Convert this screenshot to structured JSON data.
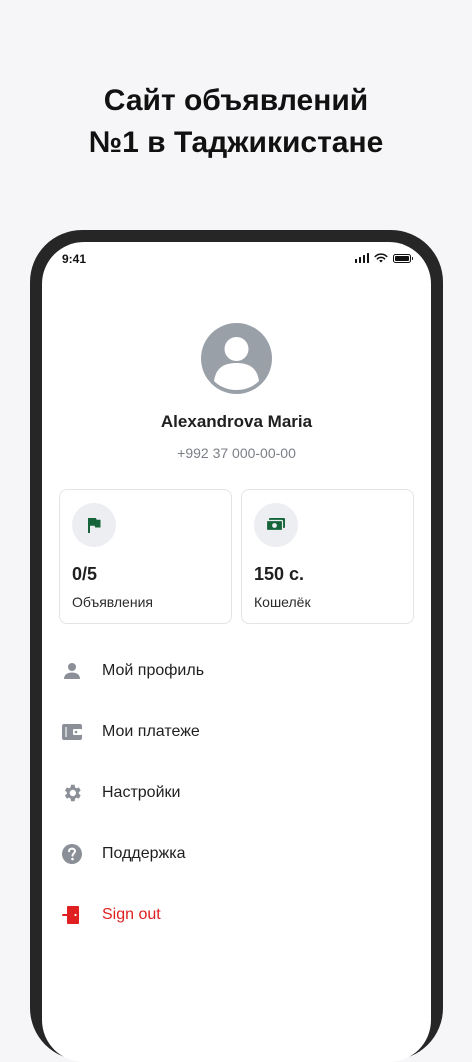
{
  "promo": {
    "line1": "Сайт объявлений",
    "line2": "№1 в Таджикистане"
  },
  "status_bar": {
    "time": "9:41",
    "icons": [
      "signal-icon",
      "wifi-icon",
      "battery-icon"
    ]
  },
  "profile": {
    "name": "Alexandrova Maria",
    "phone": "+992 37 000-00-00"
  },
  "cards": [
    {
      "icon": "flag-icon",
      "value": "0/5",
      "label": "Объявления"
    },
    {
      "icon": "money-icon",
      "value": "150 с.",
      "label": "Кошелёк"
    }
  ],
  "menu": [
    {
      "icon": "person-icon",
      "label": "Мой профиль"
    },
    {
      "icon": "wallet-icon",
      "label": "Мои платеже"
    },
    {
      "icon": "gear-icon",
      "label": "Настройки"
    },
    {
      "icon": "help-icon",
      "label": "Поддержка"
    },
    {
      "icon": "exit-door-icon",
      "label": "Sign out"
    }
  ],
  "colors": {
    "accent_green": "#16653a",
    "icon_gray": "#8b9098",
    "danger_red": "#e02020",
    "avatar_gray": "#9aa0a8"
  }
}
